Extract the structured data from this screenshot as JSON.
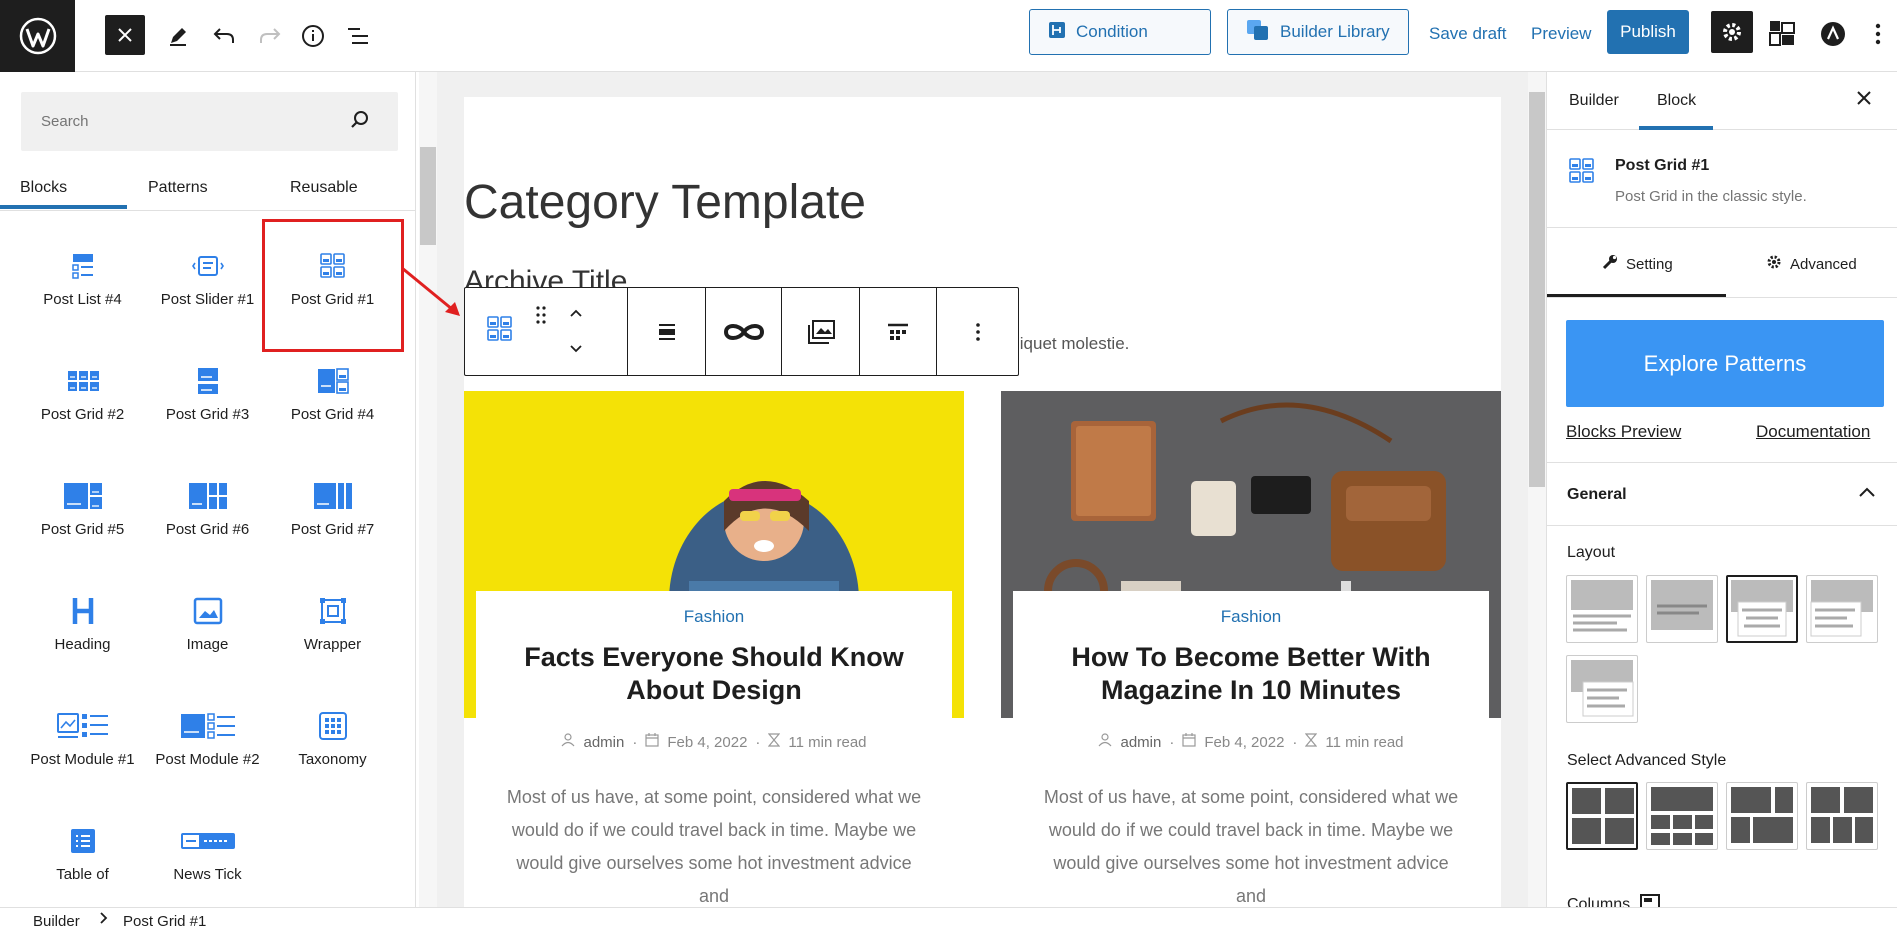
{
  "topbar": {
    "condition_label": "Condition",
    "builder_library_label": "Builder Library",
    "save_draft_label": "Save draft",
    "preview_label": "Preview",
    "publish_label": "Publish",
    "accent_color": "#2271b1"
  },
  "left_panel": {
    "search_placeholder": "Search",
    "tabs": [
      "Blocks",
      "Patterns",
      "Reusable"
    ],
    "active_tab": "Blocks",
    "blocks": [
      {
        "label": "Post List #4",
        "icon": "post-list-icon"
      },
      {
        "label": "Post Slider #1",
        "icon": "post-slider-icon"
      },
      {
        "label": "Post Grid #1",
        "icon": "post-grid-icon"
      },
      {
        "label": "Post Grid #2",
        "icon": "post-grid-icon"
      },
      {
        "label": "Post Grid #3",
        "icon": "post-grid-icon"
      },
      {
        "label": "Post Grid #4",
        "icon": "post-grid-icon"
      },
      {
        "label": "Post Grid #5",
        "icon": "post-grid-icon"
      },
      {
        "label": "Post Grid #6",
        "icon": "post-grid-icon"
      },
      {
        "label": "Post Grid #7",
        "icon": "post-grid-icon"
      },
      {
        "label": "Heading",
        "icon": "heading-icon"
      },
      {
        "label": "Image",
        "icon": "image-icon"
      },
      {
        "label": "Wrapper",
        "icon": "wrapper-icon"
      },
      {
        "label": "Post Module #1",
        "icon": "post-module-icon"
      },
      {
        "label": "Post Module #2",
        "icon": "post-module-icon"
      },
      {
        "label": "Taxonomy",
        "icon": "taxonomy-icon"
      },
      {
        "label": "Table of",
        "icon": "table-of-contents-icon"
      },
      {
        "label": "News Tick",
        "icon": "news-ticker-icon"
      }
    ]
  },
  "canvas": {
    "page_title": "Category Template",
    "archive_title": "Archive Title",
    "description_fragment": "liquet molestie.",
    "cards": [
      {
        "category": "Fashion",
        "title": "Facts Everyone Should Know About Design",
        "author": "admin",
        "date": "Feb 4, 2022",
        "read_time": "11 min read",
        "excerpt": "Most of us have, at some point, considered what we would do if we could travel back in time. Maybe we would give ourselves some hot investment advice and"
      },
      {
        "category": "Fashion",
        "title": "How To Become Better With Magazine In 10 Minutes",
        "author": "admin",
        "date": "Feb 4, 2022",
        "read_time": "11 min read",
        "excerpt": "Most of us have, at some point, considered what we would do if we could travel back in time. Maybe we would give ourselves some hot investment advice and"
      }
    ]
  },
  "right_panel": {
    "tabs": [
      "Builder",
      "Block"
    ],
    "active_tab": "Block",
    "block_name": "Post Grid #1",
    "block_description": "Post Grid in the classic style.",
    "setting_tab": "Setting",
    "advanced_tab": "Advanced",
    "explore_patterns": "Explore Patterns",
    "blocks_preview": "Blocks Preview",
    "documentation": "Documentation",
    "general": "General",
    "layout_label": "Layout",
    "advanced_style_label": "Select Advanced Style",
    "columns_label": "Columns",
    "explore_color": "#3a95f3"
  },
  "breadcrumb": {
    "root": "Builder",
    "current": "Post Grid #1"
  }
}
